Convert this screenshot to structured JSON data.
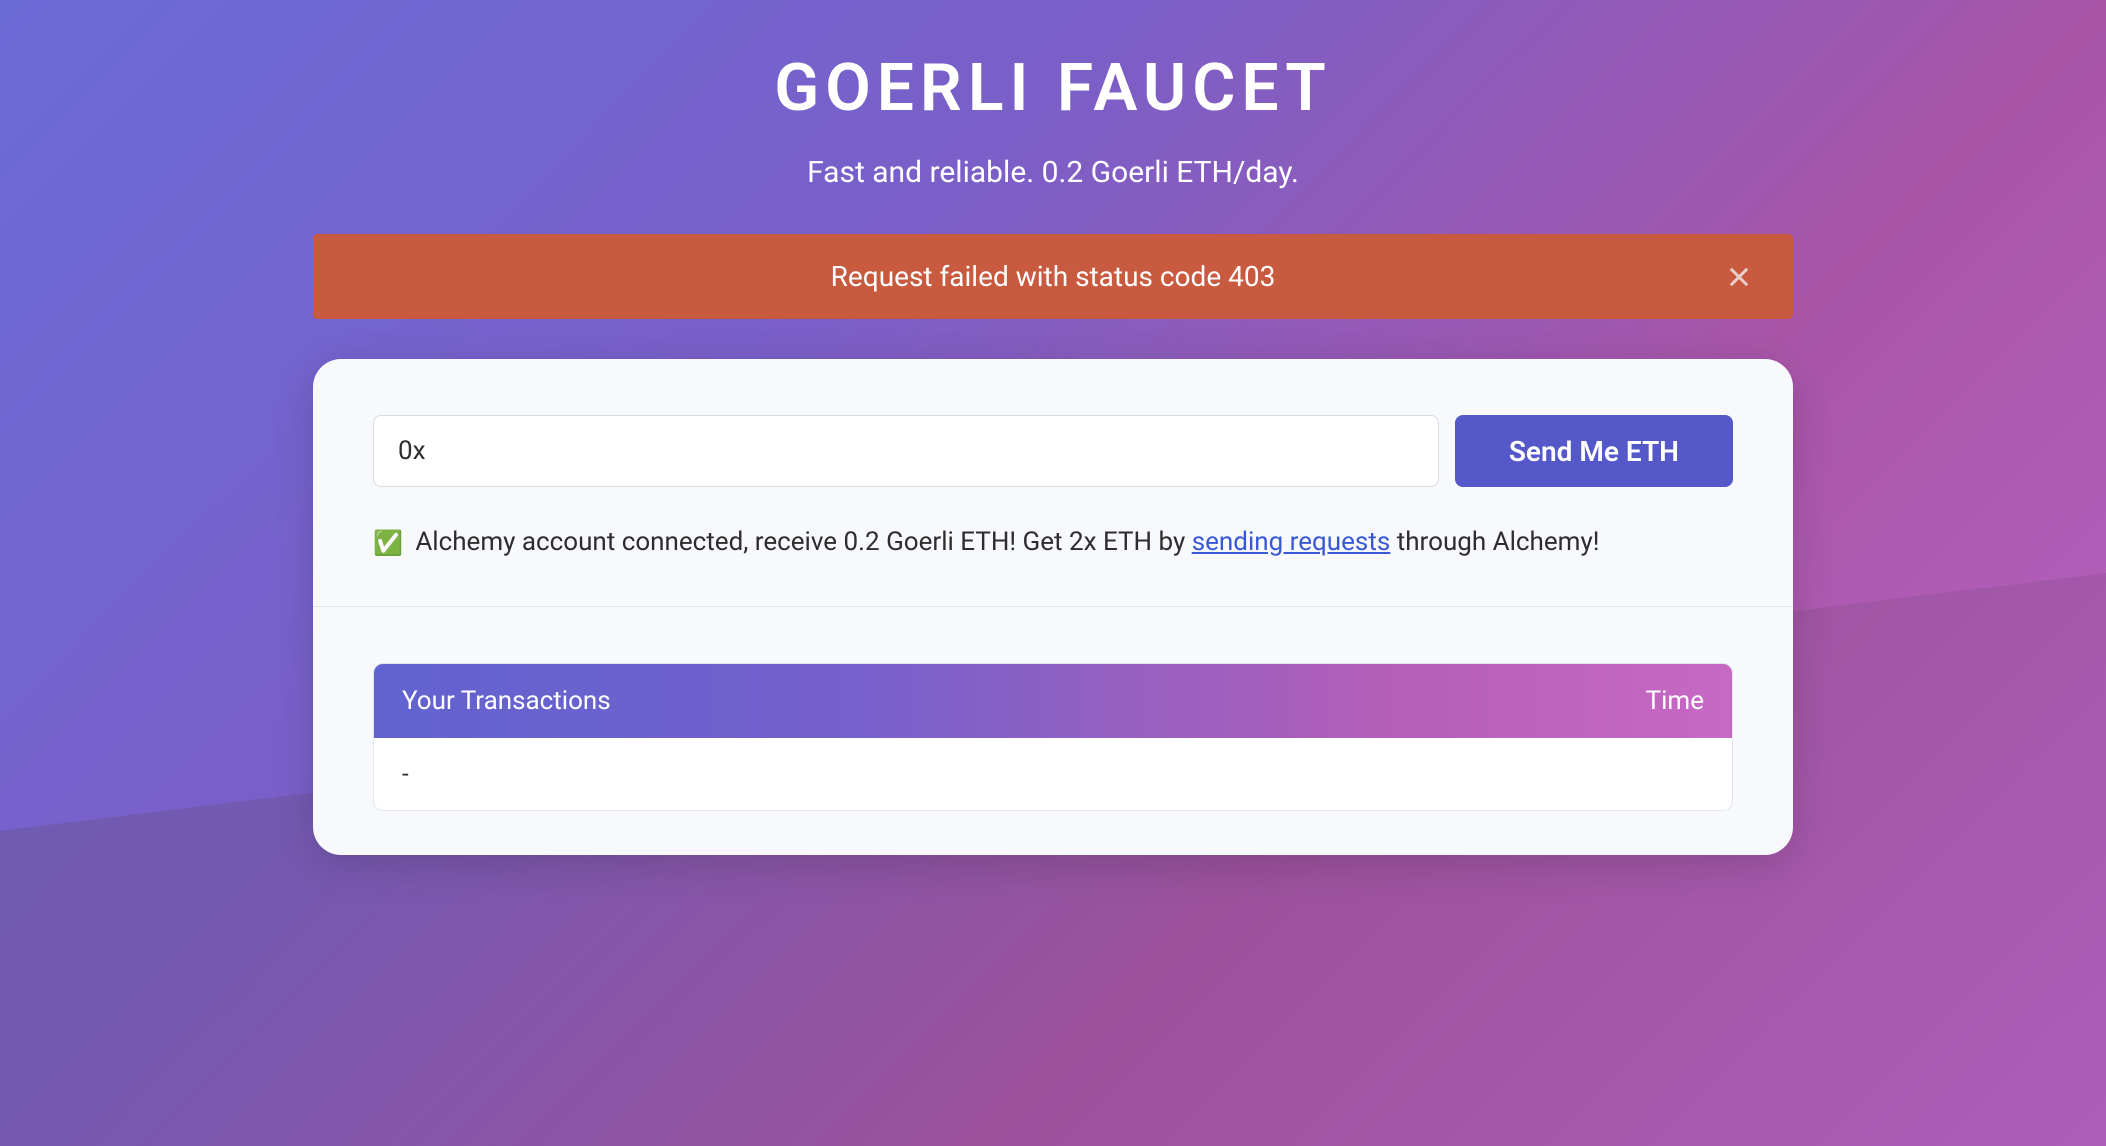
{
  "header": {
    "title": "GOERLI FAUCET",
    "subtitle": "Fast and reliable. 0.2 Goerli ETH/day."
  },
  "alert": {
    "message": "Request failed with status code 403"
  },
  "form": {
    "address_value": "0x",
    "send_label": "Send Me ETH"
  },
  "status": {
    "icon": "✅",
    "text_before": " Alchemy account connected, receive 0.2 Goerli ETH! Get 2x ETH by ",
    "link_text": "sending requests",
    "text_after": " through Alchemy!"
  },
  "transactions": {
    "header_left": "Your Transactions",
    "header_right": "Time",
    "empty_row": "-"
  }
}
